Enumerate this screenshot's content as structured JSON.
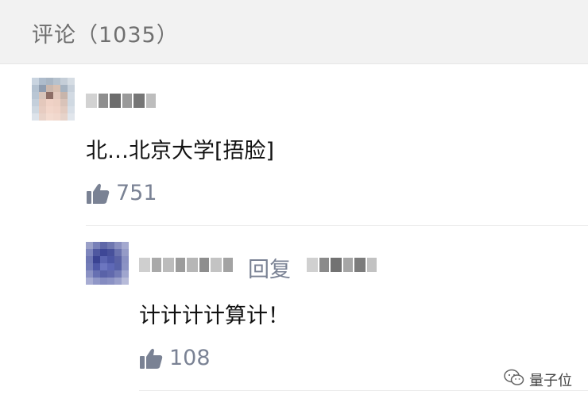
{
  "header": {
    "title": "评论（1035）"
  },
  "comments": [
    {
      "text": "北…北京大学[捂脸]",
      "likes": "751",
      "reply": {
        "reply_word": "回复",
        "text": "计计计计算计！",
        "likes": "108"
      }
    }
  ],
  "watermark": {
    "text": "量子位"
  },
  "icons": {
    "like": "thumbs-up-icon",
    "watermark_logo": "wechat-logo-icon"
  },
  "colors": {
    "header_bg": "#f2f2f2",
    "header_text": "#6f6f6f",
    "muted_text": "#7a8294",
    "body_text": "#111111"
  }
}
